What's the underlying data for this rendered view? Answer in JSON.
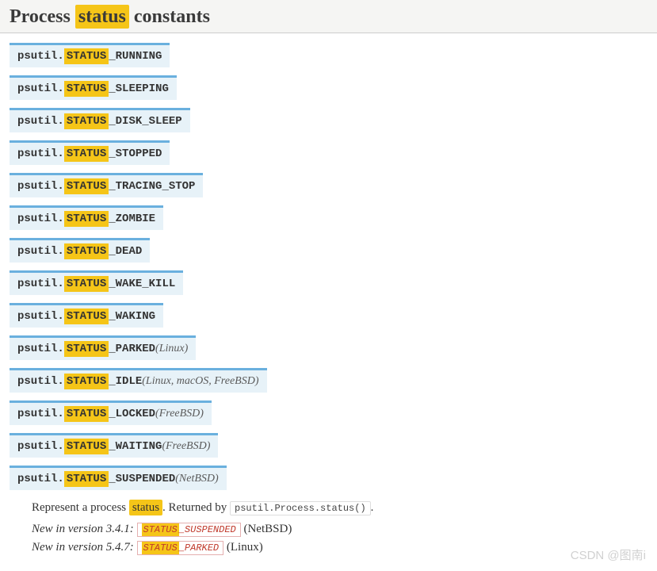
{
  "heading": {
    "pre": "Process ",
    "hl": "status",
    "post": " constants"
  },
  "sig": {
    "module": "psutil.",
    "hl": "STATUS"
  },
  "constants": [
    {
      "suffix": "_RUNNING",
      "platform": null
    },
    {
      "suffix": "_SLEEPING",
      "platform": null
    },
    {
      "suffix": "_DISK_SLEEP",
      "platform": null
    },
    {
      "suffix": "_STOPPED",
      "platform": null
    },
    {
      "suffix": "_TRACING_STOP",
      "platform": null
    },
    {
      "suffix": "_ZOMBIE",
      "platform": null
    },
    {
      "suffix": "_DEAD",
      "platform": null
    },
    {
      "suffix": "_WAKE_KILL",
      "platform": null
    },
    {
      "suffix": "_WAKING",
      "platform": null
    },
    {
      "suffix": "_PARKED",
      "platform": "Linux"
    },
    {
      "suffix": "_IDLE",
      "platform": "Linux, macOS, FreeBSD"
    },
    {
      "suffix": "_LOCKED",
      "platform": "FreeBSD"
    },
    {
      "suffix": "_WAITING",
      "platform": "FreeBSD"
    },
    {
      "suffix": "_SUSPENDED",
      "platform": "NetBSD"
    }
  ],
  "desc": {
    "pre": "Represent a process ",
    "hl": "status",
    "mid": ". Returned by ",
    "code": "psutil.Process.status()",
    "post": "."
  },
  "versions": [
    {
      "label": "New in version 3.4.1:",
      "const_hl": "STATUS",
      "const_suffix": "_SUSPENDED",
      "platform": "(NetBSD)"
    },
    {
      "label": "New in version 5.4.7:",
      "const_hl": "STATUS",
      "const_suffix": "_PARKED",
      "platform": "(Linux)"
    }
  ],
  "watermark": "CSDN @图南i"
}
